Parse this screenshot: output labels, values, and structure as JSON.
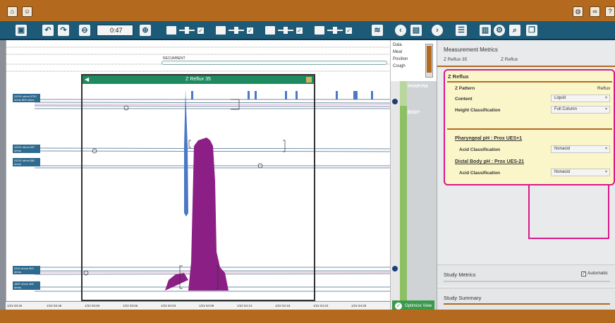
{
  "titlebar": {
    "home_icon": "home-icon",
    "user_icon": "user-icon",
    "right_icons": [
      "globe-icon",
      "link-icon",
      "help-icon"
    ],
    "help_label": "?"
  },
  "toolbar": {
    "time_value": "0:47",
    "tools_left": [
      "save-icon",
      "undo-icon",
      "redo-icon",
      "zoom-in-icon"
    ],
    "tools_right": [
      "prev-icon",
      "report-icon",
      "next-icon",
      "list-icon",
      "window-icon",
      "settings-icon",
      "zoom-icon",
      "copy-icon"
    ]
  },
  "events": {
    "items": [
      "Data",
      "Meal",
      "Position",
      "Cough"
    ]
  },
  "recumbent_label": "RECUMBENT",
  "zwindow": {
    "title": "Z Reflux 35"
  },
  "track_labels": [
    {
      "text": "XXXX ohms 5720 ohms 803 ohms"
    },
    {
      "text": "XXXX ohms 597 ohms"
    },
    {
      "text": "XXXX ohms 581 ohms"
    },
    {
      "text": "2910 ohms 903 ohms"
    },
    {
      "text": "1857 ohms 408 ohms"
    }
  ],
  "regions": {
    "pharynx": "PHARYNX",
    "body": "BODY"
  },
  "axis": {
    "ticks": [
      "1/22 93:46",
      "1/22 93:48",
      "1/22 93:50",
      "1/22 93:56",
      "1/22 94:03",
      "1/22 94:08",
      "1/22 94:13",
      "1/22 94:18",
      "1/22 94:23",
      "1/22 94:28"
    ]
  },
  "optimize": {
    "label": "Optimize View"
  },
  "right_panel": {
    "title": "Measurement Metrics",
    "sub_left": "Z Reflux 35",
    "sub_right": "Z Reflux",
    "zreflux": {
      "heading": "Z Reflux",
      "z_pattern_label": "Z Pattern",
      "z_pattern_value": "Reflux",
      "content_label": "Content",
      "content_value": "Liquid",
      "height_label": "Height Classification",
      "height_value": "Full Column",
      "pharyngeal_link": "Pharyngeal pH : Prox UES+1",
      "acid1_label": "Acid Classification",
      "acid1_value": "Nonacid",
      "distal_link": "Distal Body pH : Prox UES-21",
      "acid2_label": "Acid Classification",
      "acid2_value": "Nonacid"
    },
    "study_metrics": {
      "title": "Study Metrics",
      "automatic_label": "Automatic"
    },
    "study_summary": {
      "title": "Study Summary"
    }
  },
  "colors": {
    "accent": "#b36a1f",
    "toolbar": "#1c5a78",
    "highlight": "#d9198a",
    "plot_purple": "#8c1f86",
    "plot_blue": "#4a78c4"
  }
}
